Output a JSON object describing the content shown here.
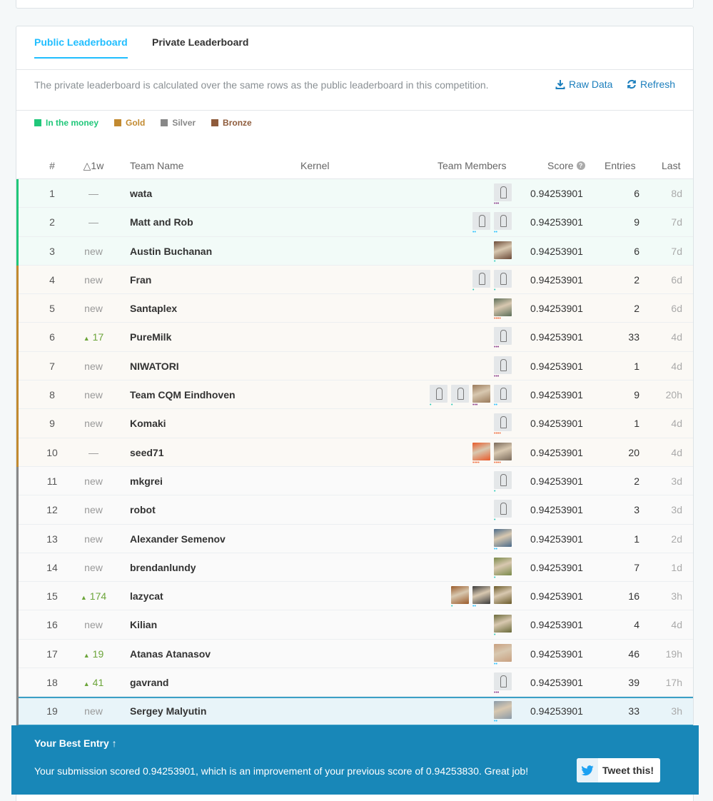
{
  "tabs": {
    "public": "Public Leaderboard",
    "private": "Private Leaderboard"
  },
  "notice": {
    "text": "The private leaderboard is calculated over the same rows as the public leaderboard in this competition.",
    "raw_data": "Raw Data",
    "refresh": "Refresh"
  },
  "legend": [
    {
      "label": "In the money",
      "color": "#20c77a"
    },
    {
      "label": "Gold",
      "color": "#c28a30"
    },
    {
      "label": "Silver",
      "color": "#888888"
    },
    {
      "label": "Bronze",
      "color": "#8e5b3b"
    }
  ],
  "columns": {
    "rank": "#",
    "change": "△1w",
    "team": "Team Name",
    "kernel": "Kernel",
    "members": "Team Members",
    "score": "Score",
    "entries": "Entries",
    "last": "Last"
  },
  "rows": [
    {
      "rank": "1",
      "change": "—",
      "team": "wata",
      "score": "0.94253901",
      "entries": "6",
      "last": "8d",
      "tier": "money",
      "avatars": [
        {
          "type": "def",
          "dots": "•••",
          "dc": "#8b3a8a"
        }
      ]
    },
    {
      "rank": "2",
      "change": "—",
      "team": "Matt and Rob",
      "score": "0.94253901",
      "entries": "9",
      "last": "7d",
      "tier": "money",
      "avatars": [
        {
          "type": "def",
          "dots": "••",
          "dc": "#20beff"
        },
        {
          "type": "def",
          "dots": "••",
          "dc": "#20beff"
        }
      ]
    },
    {
      "rank": "3",
      "change": "new",
      "team": "Austin Buchanan",
      "score": "0.94253901",
      "entries": "6",
      "last": "7d",
      "tier": "money",
      "avatars": [
        {
          "type": "photo",
          "color": "#6b4a38",
          "dots": "•",
          "dc": "#20c7b5"
        }
      ]
    },
    {
      "rank": "4",
      "change": "new",
      "team": "Fran",
      "score": "0.94253901",
      "entries": "2",
      "last": "6d",
      "tier": "gold",
      "avatars": [
        {
          "type": "def",
          "dots": "•",
          "dc": "#20c7b5"
        },
        {
          "type": "def",
          "dots": "•",
          "dc": "#20c7b5"
        }
      ]
    },
    {
      "rank": "5",
      "change": "new",
      "team": "Santaplex",
      "score": "0.94253901",
      "entries": "2",
      "last": "6d",
      "tier": "gold",
      "avatars": [
        {
          "type": "photo",
          "color": "#5c6e58",
          "dots": "••••",
          "dc": "#f06a3a"
        }
      ]
    },
    {
      "rank": "6",
      "change": "17",
      "up": true,
      "team": "PureMilk",
      "score": "0.94253901",
      "entries": "33",
      "last": "4d",
      "tier": "gold",
      "avatars": [
        {
          "type": "def",
          "dots": "•••",
          "dc": "#8b3a8a"
        }
      ]
    },
    {
      "rank": "7",
      "change": "new",
      "team": "NIWATORI",
      "score": "0.94253901",
      "entries": "1",
      "last": "4d",
      "tier": "gold",
      "avatars": [
        {
          "type": "def",
          "dots": "•••",
          "dc": "#8b3a8a"
        }
      ]
    },
    {
      "rank": "8",
      "change": "new",
      "team": "Team CQM Eindhoven",
      "score": "0.94253901",
      "entries": "9",
      "last": "20h",
      "tier": "gold",
      "avatars": [
        {
          "type": "def",
          "dots": "•",
          "dc": "#20c7b5"
        },
        {
          "type": "def",
          "dots": "•",
          "dc": "#20c7b5"
        },
        {
          "type": "photo",
          "color": "#9a7a5a",
          "dots": "•••",
          "dc": "#8b3a8a"
        },
        {
          "type": "def",
          "dots": "••",
          "dc": "#20beff"
        }
      ]
    },
    {
      "rank": "9",
      "change": "new",
      "team": "Komaki",
      "score": "0.94253901",
      "entries": "1",
      "last": "4d",
      "tier": "gold",
      "avatars": [
        {
          "type": "def",
          "dots": "••••",
          "dc": "#f06a3a"
        }
      ]
    },
    {
      "rank": "10",
      "change": "—",
      "team": "seed71",
      "score": "0.94253901",
      "entries": "20",
      "last": "4d",
      "tier": "gold",
      "avatars": [
        {
          "type": "photo",
          "color": "#e85a2a",
          "dots": "••••",
          "dc": "#f06a3a"
        },
        {
          "type": "photo",
          "color": "#7a6a5a",
          "dots": "••••",
          "dc": "#f06a3a"
        }
      ]
    },
    {
      "rank": "11",
      "change": "new",
      "team": "mkgrei",
      "score": "0.94253901",
      "entries": "2",
      "last": "3d",
      "tier": "silver",
      "avatars": [
        {
          "type": "def",
          "dots": "•",
          "dc": "#20c7b5"
        }
      ]
    },
    {
      "rank": "12",
      "change": "new",
      "team": "robot",
      "score": "0.94253901",
      "entries": "3",
      "last": "3d",
      "tier": "silver",
      "avatars": [
        {
          "type": "def",
          "dots": "•",
          "dc": "#20c7b5"
        }
      ]
    },
    {
      "rank": "13",
      "change": "new",
      "team": "Alexander Semenov",
      "score": "0.94253901",
      "entries": "1",
      "last": "2d",
      "tier": "silver",
      "avatars": [
        {
          "type": "photo",
          "color": "#4a6a8a",
          "dots": "••",
          "dc": "#20beff"
        }
      ]
    },
    {
      "rank": "14",
      "change": "new",
      "team": "brendanlundy",
      "score": "0.94253901",
      "entries": "7",
      "last": "1d",
      "tier": "silver",
      "avatars": [
        {
          "type": "photo",
          "color": "#7a8a4a",
          "dots": "•",
          "dc": "#20c7b5"
        }
      ]
    },
    {
      "rank": "15",
      "change": "174",
      "up": true,
      "team": "lazycat",
      "score": "0.94253901",
      "entries": "16",
      "last": "3h",
      "tier": "silver",
      "avatars": [
        {
          "type": "photo",
          "color": "#9a5a2a",
          "dots": "•",
          "dc": "#20c7b5"
        },
        {
          "type": "photo",
          "color": "#3a3a3a",
          "dots": "••",
          "dc": "#20beff"
        },
        {
          "type": "photo",
          "color": "#6a5a2a",
          "dots": "",
          "dc": "#20beff"
        }
      ]
    },
    {
      "rank": "16",
      "change": "new",
      "team": "Kilian",
      "score": "0.94253901",
      "entries": "4",
      "last": "4d",
      "tier": "silver",
      "avatars": [
        {
          "type": "photo",
          "color": "#6a6a3a",
          "dots": "•",
          "dc": "#20c7b5"
        }
      ]
    },
    {
      "rank": "17",
      "change": "19",
      "up": true,
      "team": "Atanas Atanasov",
      "score": "0.94253901",
      "entries": "46",
      "last": "19h",
      "tier": "silver",
      "avatars": [
        {
          "type": "photo",
          "color": "#c8a080",
          "dots": "••",
          "dc": "#20beff"
        }
      ]
    },
    {
      "rank": "18",
      "change": "41",
      "up": true,
      "team": "gavrand",
      "score": "0.94253901",
      "entries": "39",
      "last": "17h",
      "tier": "silver",
      "avatars": [
        {
          "type": "def",
          "dots": "•••",
          "dc": "#8b3a8a"
        }
      ]
    },
    {
      "rank": "19",
      "change": "new",
      "team": "Sergey Malyutin",
      "score": "0.94253901",
      "entries": "33",
      "last": "3h",
      "tier": "mine",
      "avatars": [
        {
          "type": "photo",
          "color": "#8a9aa8",
          "dots": "••",
          "dc": "#20beff"
        }
      ]
    }
  ],
  "tier_colors": {
    "money": "#20c77a",
    "gold": "#c28a30",
    "silver": "#888888",
    "mine": "#888888"
  },
  "best_entry": {
    "title": "Your Best Entry",
    "message": "Your submission scored 0.94253901, which is an improvement of your previous score of 0.94253830. Great job!",
    "tweet": "Tweet this!"
  }
}
